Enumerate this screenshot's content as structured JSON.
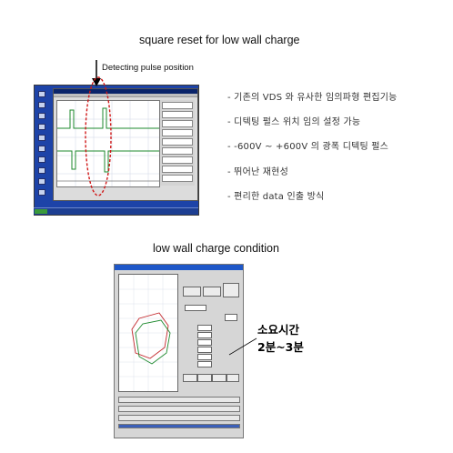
{
  "section1": {
    "title": "square reset for low wall charge",
    "arrow_label": "Detecting pulse position",
    "bullets": [
      "- 기존의 VDS 와 유사한 임의파형 편집기능",
      "- 디텍팅 펄스 위치 임의 설정 가능",
      "- -600V ~ +600V 의 광폭 디텍팅 펄스",
      "- 뛰어난 재현성",
      "- 편리한 data 인출 방식"
    ]
  },
  "section2": {
    "title": "low wall charge condition",
    "callout_line1": "소요시간",
    "callout_line2": "2분~3분"
  },
  "colors": {
    "ellipse": "#d01818",
    "desktop": "#1d43a8",
    "trace_green": "#1e8a2e",
    "trace_red": "#c4282c"
  }
}
